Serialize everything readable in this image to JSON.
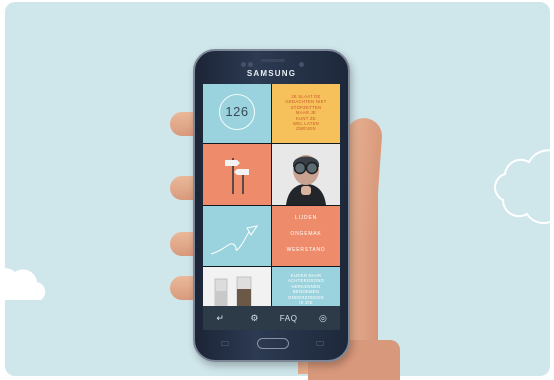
{
  "phone": {
    "brand": "SAMSUNG"
  },
  "tiles": {
    "counter": "126",
    "yellow_text": [
      "JE SLAAT DE",
      "GEDACHTEN NIET",
      "STOPZETTEN",
      "MAAR JE",
      "KUNT ZE",
      "WEL LATEN",
      "ZWEVEN"
    ],
    "words": [
      "LIJDEN",
      "ONGEMAK",
      "WEERSTAND"
    ],
    "blue_text": [
      "KIJKEN NAAR",
      "ACHTERGROND",
      "HERKENNEN",
      "BENOEMEN",
      "ONDERZOEKEN",
      "IK ZIE"
    ]
  },
  "toolbar": {
    "back_icon": "↵",
    "settings_icon": "⚙",
    "faq_label": "FAQ",
    "profile_icon": "◎"
  },
  "colors": {
    "background": "#cfe6eb",
    "tile_blue": "#9ad3de",
    "tile_yellow": "#f6c15a",
    "tile_salmon": "#ee8b6b",
    "toolbar": "#2d3a48"
  }
}
